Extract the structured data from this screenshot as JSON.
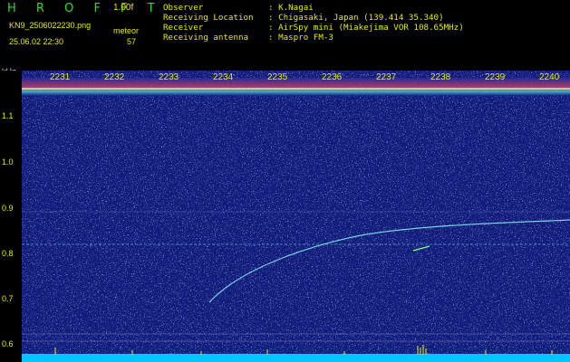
{
  "header": {
    "logo": "H R O F F T",
    "version": "1.00f",
    "filename": "KN9_2506022230.png",
    "meteor_label": "meteor",
    "datetime": "25.06.02 22:30",
    "meteor_count": "57"
  },
  "info": [
    {
      "key": "Observer",
      "value": ": K.Nagai"
    },
    {
      "key": "Receiving Location",
      "value": ": Chigasaki, Japan (139.414 35.340)"
    },
    {
      "key": "Receiver",
      "value": ": AirSpy mini (Miakejima VOR 108.65MHz)"
    },
    {
      "key": "Receiving antenna",
      "value": ": Maspro FM-3"
    }
  ],
  "axis": {
    "unit": "kHz",
    "y_ticks": [
      "1.1",
      "1.0",
      "0.9",
      "0.8",
      "0.7",
      "0.6"
    ],
    "time_ticks": [
      "2231",
      "2232",
      "2233",
      "2234",
      "2235",
      "2236",
      "2237",
      "2238",
      "2239",
      "2240"
    ]
  },
  "colors": {
    "text": "#e8e800",
    "logo": "#22e022",
    "background": "#121a7a",
    "trace": "#7fe8e8",
    "bottom_band": "#00c8ff"
  }
}
